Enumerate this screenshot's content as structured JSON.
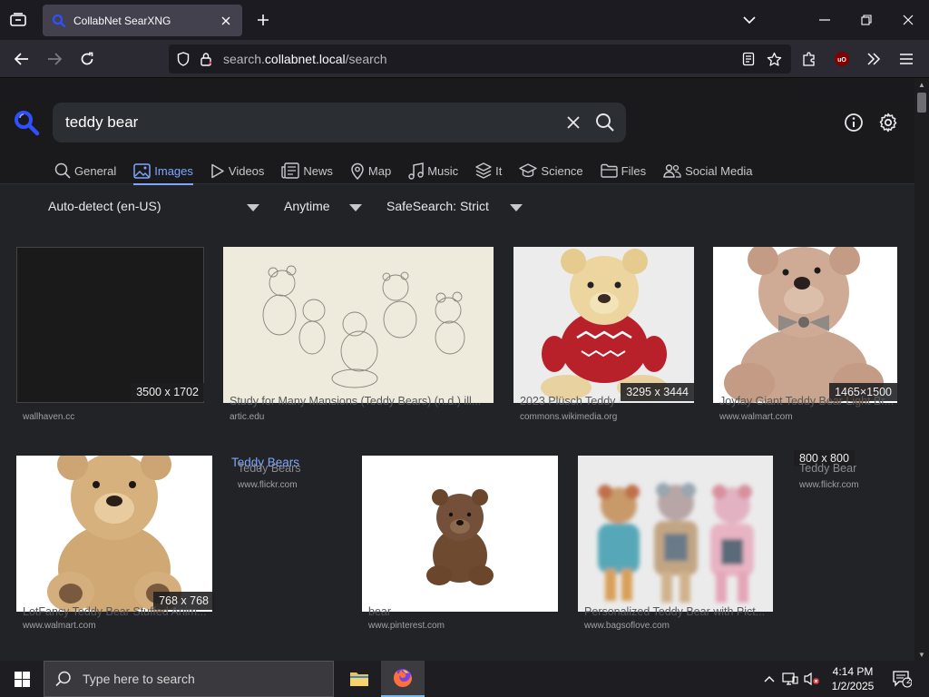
{
  "browser": {
    "tab_title": "CollabNet SearXNG",
    "url_prefix": "search.",
    "url_host": "collabnet.local",
    "url_path": "/search"
  },
  "search": {
    "query": "teddy bear"
  },
  "categories": [
    {
      "label": "General",
      "icon": "search-icon"
    },
    {
      "label": "Images",
      "icon": "image-icon",
      "active": true
    },
    {
      "label": "Videos",
      "icon": "play-icon"
    },
    {
      "label": "News",
      "icon": "newspaper-icon"
    },
    {
      "label": "Map",
      "icon": "map-pin-icon"
    },
    {
      "label": "Music",
      "icon": "music-icon"
    },
    {
      "label": "It",
      "icon": "layers-icon"
    },
    {
      "label": "Science",
      "icon": "graduation-cap-icon"
    },
    {
      "label": "Files",
      "icon": "folder-icon"
    },
    {
      "label": "Social Media",
      "icon": "users-icon"
    }
  ],
  "filters": {
    "language": "Auto-detect (en-US)",
    "time": "Anytime",
    "safesearch": "SafeSearch: Strict"
  },
  "results": [
    {
      "size": "3500 x 1702",
      "title": "",
      "source": "wallhaven.cc"
    },
    {
      "size": "",
      "title": "Study for Many Mansions (Teddy Bears) (n.d.) ill...",
      "source": "artic.edu"
    },
    {
      "size": "3295 x 3444",
      "title": "2023 Plüsch Teddy Bear",
      "source": "commons.wikimedia.org"
    },
    {
      "size": "1465×1500",
      "title": "Joyfay Giant Teddy Bear Light Br...",
      "source": "www.walmart.com"
    },
    {
      "size": "768 x 768",
      "title": "LotFancy Teddy Bear Stuffed Anim...",
      "source": "www.walmart.com"
    },
    {
      "size": "",
      "title": "Teddy Bears",
      "link": "Teddy Bears",
      "source": "www.flickr.com"
    },
    {
      "size": "",
      "title": "bear",
      "source": "www.pinterest.com"
    },
    {
      "size": "",
      "title": "Personalized Teddy Bear with Pict...",
      "source": "www.bagsoflove.com"
    },
    {
      "size": "800 x 800",
      "title": "Teddy Bear",
      "source": "www.flickr.com"
    }
  ],
  "taskbar": {
    "search_placeholder": "Type here to search",
    "time": "4:14 PM",
    "date": "1/2/2025",
    "notification_count": "2"
  }
}
